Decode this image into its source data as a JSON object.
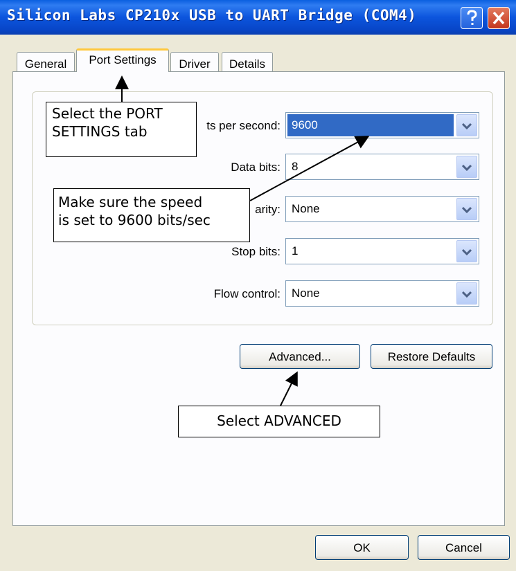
{
  "window": {
    "title": "Silicon Labs CP210x USB to UART Bridge (COM4)",
    "help_label": "?",
    "colors": {
      "titlebar": "#0a5fe0",
      "selection": "#316ac5",
      "tab_highlight": "#ffc83c"
    }
  },
  "tabs": [
    {
      "label": "General",
      "active": false
    },
    {
      "label": "Port Settings",
      "active": true
    },
    {
      "label": "Driver",
      "active": false
    },
    {
      "label": "Details",
      "active": false
    }
  ],
  "fields": {
    "bits_per_second": {
      "label": "Bits per second:",
      "visible_label": "ts per second:",
      "value": "9600"
    },
    "data_bits": {
      "label": "Data bits:",
      "value": "8"
    },
    "parity": {
      "label": "Parity:",
      "visible_label": "arity:",
      "value": "None"
    },
    "stop_bits": {
      "label": "Stop bits:",
      "value": "1"
    },
    "flow_control": {
      "label": "Flow control:",
      "value": "None"
    }
  },
  "buttons": {
    "advanced": "Advanced...",
    "restore_defaults": "Restore Defaults",
    "ok": "OK",
    "cancel": "Cancel"
  },
  "annotations": {
    "port_settings_line1": "Select the PORT",
    "port_settings_line2": "SETTINGS tab",
    "speed_line1": "Make sure the speed",
    "speed_line2": "is set to 9600 bits/sec",
    "advanced": "Select ADVANCED"
  },
  "icons": {
    "help": "question-mark-icon",
    "close": "close-x-icon",
    "dropdown": "chevron-down-icon"
  }
}
